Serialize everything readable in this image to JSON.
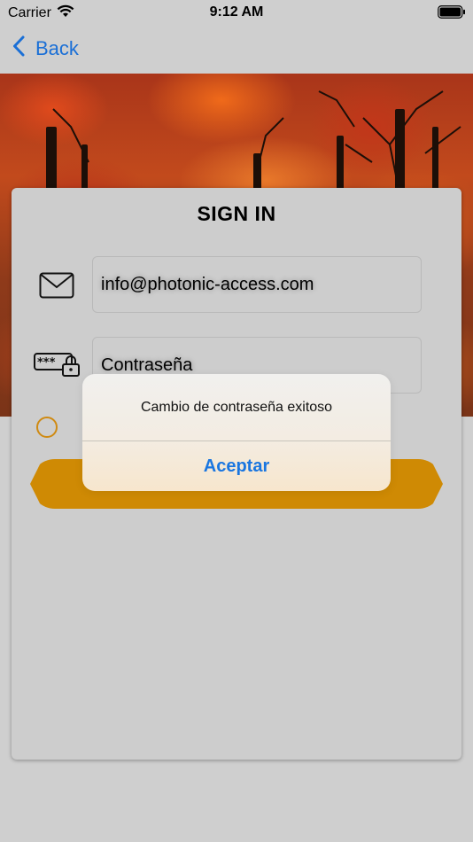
{
  "status_bar": {
    "carrier": "Carrier",
    "time": "9:12 AM"
  },
  "nav": {
    "back_label": "Back"
  },
  "card": {
    "title": "SIGN IN",
    "email_value": "info@photonic-access.com",
    "password_placeholder": "Contraseña"
  },
  "alert": {
    "message": "Cambio de contraseña exitoso",
    "button_label": "Aceptar"
  },
  "colors": {
    "accent": "#cf8a04",
    "link_blue": "#1a6fd6",
    "background": "#cfcfcf"
  },
  "icons": [
    "wifi-icon",
    "battery-icon",
    "chevron-left-icon",
    "mail-icon",
    "password-lock-icon"
  ]
}
